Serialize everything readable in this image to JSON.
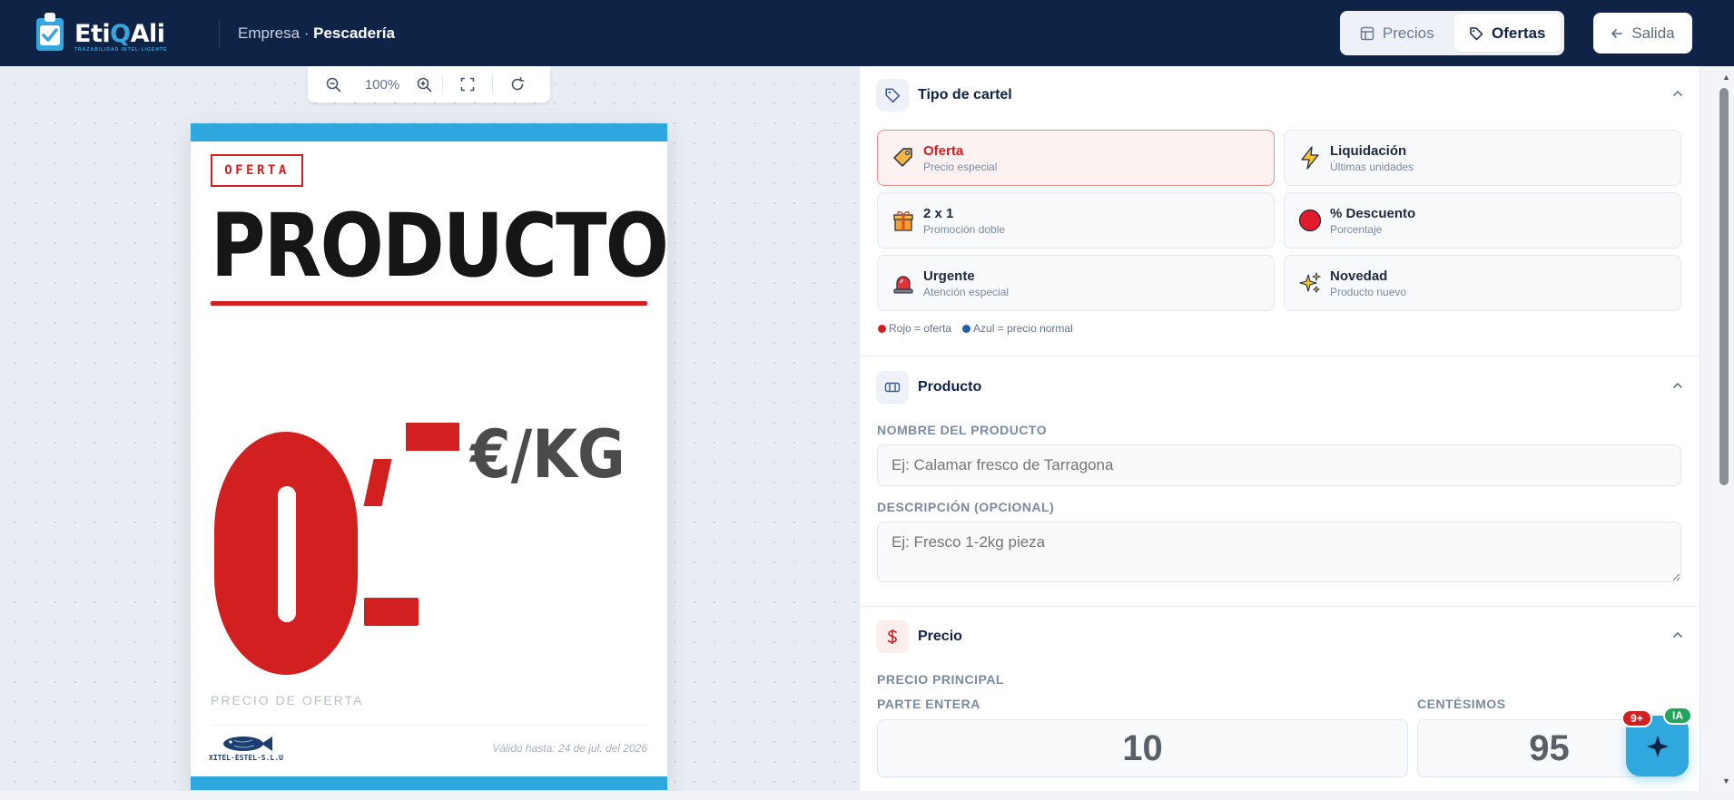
{
  "header": {
    "logo_text_part1": "Eti",
    "logo_text_q": "Q",
    "logo_text_part2": "Ali",
    "logo_tagline": "TRAZABILIDAD INTEL·LIGENTE",
    "breadcrumb_company": "Empresa",
    "breadcrumb_sep": " · ",
    "breadcrumb_section": "Pescadería",
    "tabs": [
      {
        "label": "Precios",
        "icon": "table-icon",
        "active": false
      },
      {
        "label": "Ofertas",
        "icon": "tag-icon",
        "active": true
      }
    ],
    "exit_label": "Salida"
  },
  "toolbar": {
    "zoom_level": "100%"
  },
  "poster": {
    "badge": "OFERTA",
    "product_name": "PRODUCTO",
    "unit": "€/KG",
    "price_label": "PRECIO DE OFERTA",
    "company_logo_text": "XITEL·ESTEL·S.L.U.",
    "valid_until": "Válido hasta: 24 de jul. del 2026",
    "colors": {
      "accent": "#d21f1f",
      "band": "#2ea7df"
    }
  },
  "panel": {
    "tipo": {
      "title": "Tipo de cartel",
      "options": [
        {
          "title": "Oferta",
          "subtitle": "Precio especial",
          "icon": "tag-icon",
          "selected": true
        },
        {
          "title": "Liquidación",
          "subtitle": "Últimas unidades",
          "icon": "lightning-icon",
          "selected": false
        },
        {
          "title": "2 x 1",
          "subtitle": "Promoción doble",
          "icon": "gift-icon",
          "selected": false
        },
        {
          "title": "% Descuento",
          "subtitle": "Porcentaje",
          "icon": "red-circle-icon",
          "selected": false
        },
        {
          "title": "Urgente",
          "subtitle": "Atención especial",
          "icon": "siren-icon",
          "selected": false
        },
        {
          "title": "Novedad",
          "subtitle": "Producto nuevo",
          "icon": "sparkles-icon",
          "selected": false
        }
      ],
      "legend_red": "Rojo = oferta",
      "legend_blue": "Azul = precio normal"
    },
    "producto": {
      "title": "Producto",
      "name_label": "NOMBRE DEL PRODUCTO",
      "name_placeholder": "Ej: Calamar fresco de Tarragona",
      "name_value": "",
      "desc_label": "DESCRIPCIÓN (OPCIONAL)",
      "desc_placeholder": "Ej: Fresco 1-2kg pieza",
      "desc_value": ""
    },
    "precio": {
      "title": "Precio",
      "main_label": "PRECIO PRINCIPAL",
      "int_label": "PARTE ENTERA",
      "int_value": "10",
      "cents_label": "CENTÉSIMOS",
      "cents_value": "95"
    }
  },
  "assistant": {
    "notif_badge": "9+",
    "ia_badge": "IA"
  }
}
